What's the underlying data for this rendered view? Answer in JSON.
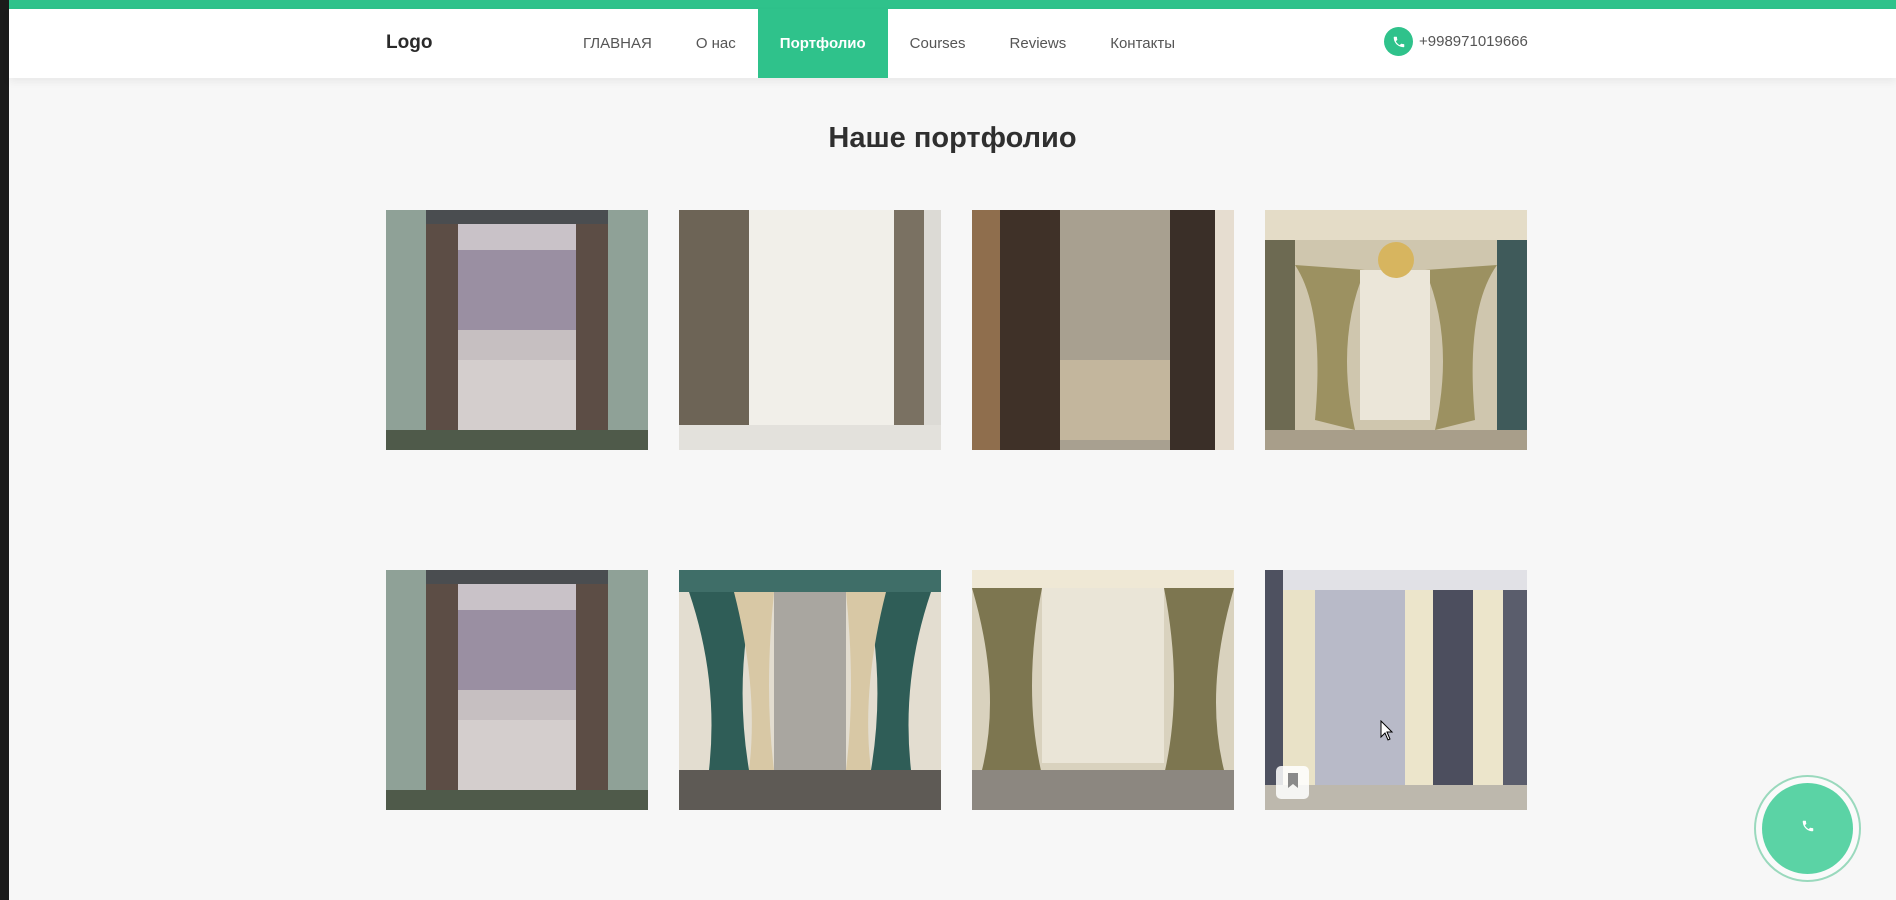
{
  "header": {
    "logo": "Logo",
    "nav": [
      {
        "label": "ГЛАВНАЯ",
        "active": false
      },
      {
        "label": "О нас",
        "active": false
      },
      {
        "label": "Портфолио",
        "active": true
      },
      {
        "label": "Courses",
        "active": false
      },
      {
        "label": "Reviews",
        "active": false
      },
      {
        "label": "Контакты",
        "active": false
      }
    ],
    "phone": "+998971019666",
    "phone_icon": "phone-icon"
  },
  "portfolio": {
    "title": "Наше портфолио",
    "images": [
      "curtain-photo",
      "curtain-photo",
      "curtain-photo",
      "curtain-photo",
      "curtain-photo",
      "curtain-photo",
      "curtain-photo",
      "curtain-photo"
    ]
  },
  "floating": {
    "call_icon": "phone-icon"
  },
  "colors": {
    "accent": "#2fc28b",
    "fab": "#5bd3a5",
    "page_bg": "#f7f7f7"
  }
}
